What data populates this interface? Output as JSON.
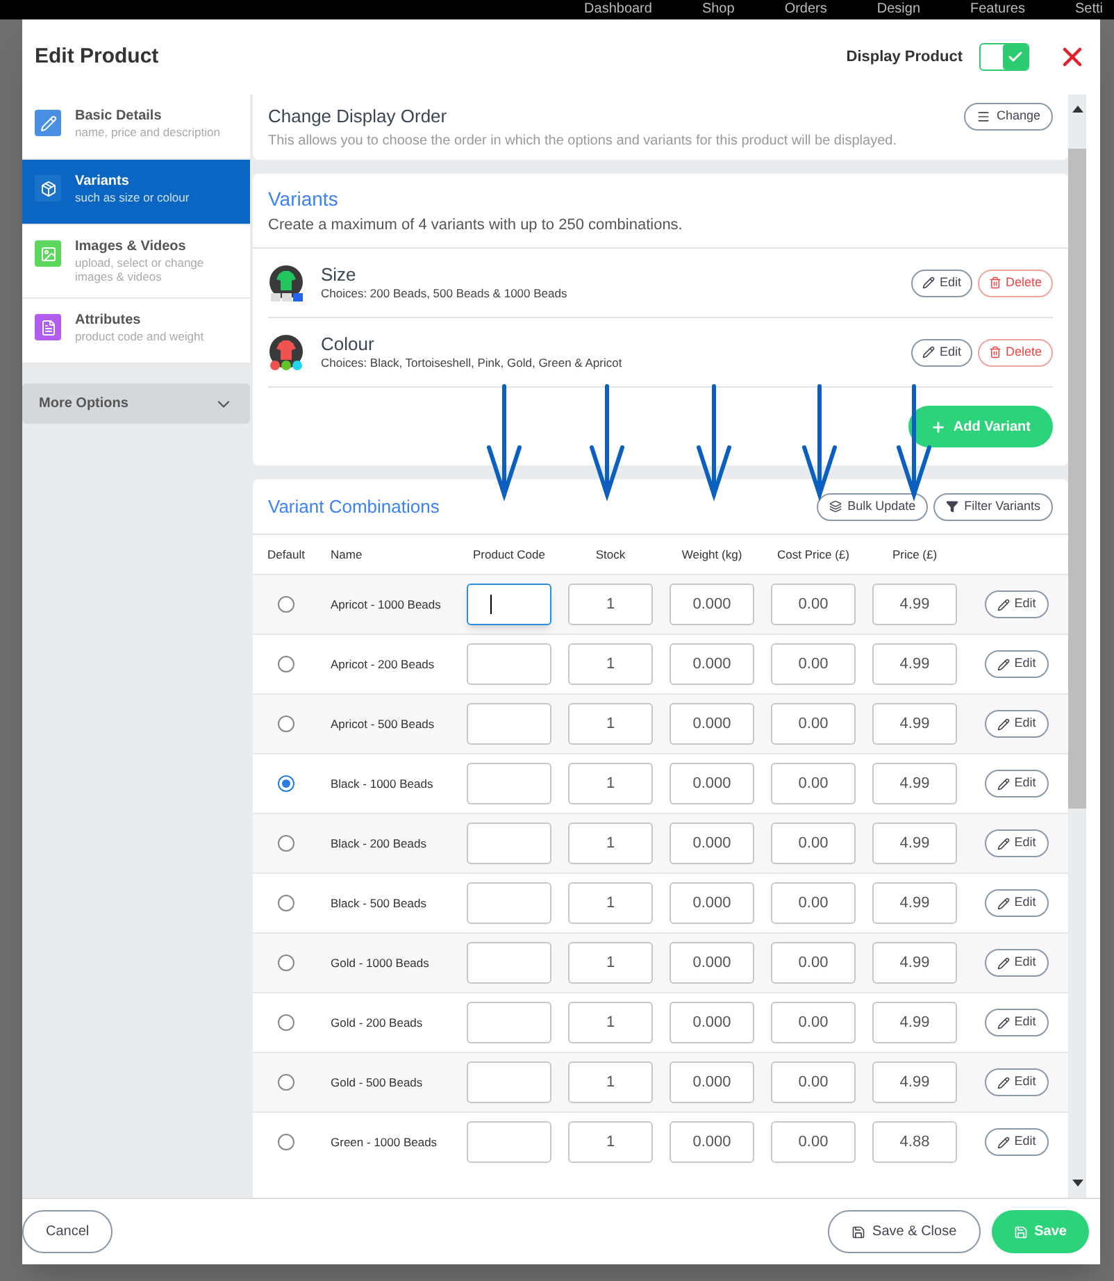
{
  "background_nav": [
    "Dashboard",
    "Shop",
    "Orders",
    "Design",
    "Features",
    "Setti"
  ],
  "dialog": {
    "title": "Edit Product",
    "display_toggle": {
      "label": "Display Product",
      "on": true
    }
  },
  "sidebar": {
    "items": [
      {
        "kind": "details",
        "title": "Basic Details",
        "subtitle": "name, price and description",
        "selected": false,
        "color": "#4a90e2"
      },
      {
        "kind": "variants",
        "title": "Variants",
        "subtitle": "such as size or colour",
        "selected": true,
        "color": "#1a73c9"
      },
      {
        "kind": "media",
        "title": "Images & Videos",
        "subtitle": "upload, select or change images & videos",
        "selected": false,
        "color": "#5cd65c"
      },
      {
        "kind": "attributes",
        "title": "Attributes",
        "subtitle": "product code and weight",
        "selected": false,
        "color": "#b35cf0"
      }
    ],
    "more_options": "More Options"
  },
  "display_order": {
    "title": "Change Display Order",
    "description": "This allows you to choose the order in which the options and variants for this product will be displayed.",
    "button": "Change"
  },
  "variants": {
    "title": "Variants",
    "description": "Create a maximum of 4 variants with up to 250 combinations.",
    "items": [
      {
        "kind": "size",
        "name": "Size",
        "choices": "Choices: 200 Beads, 500 Beads & 1000 Beads",
        "edit": "Edit",
        "delete": "Delete"
      },
      {
        "kind": "colour",
        "name": "Colour",
        "choices": "Choices: Black, Tortoiseshell, Pink, Gold, Green & Apricot",
        "edit": "Edit",
        "delete": "Delete"
      }
    ],
    "add_button": "Add Variant"
  },
  "combinations": {
    "title": "Variant Combinations",
    "bulk_button": "Bulk Update",
    "filter_button": "Filter Variants",
    "columns": [
      "Default",
      "Name",
      "Product Code",
      "Stock",
      "Weight (kg)",
      "Cost Price (£)",
      "Price (£)"
    ],
    "rows": [
      {
        "name": "Apricot - 1000 Beads",
        "stock": "1",
        "weight": "0.000",
        "cost": "0.00",
        "price": "4.99",
        "selected": false,
        "focused": true,
        "edit": "Edit"
      },
      {
        "name": "Apricot - 200 Beads",
        "stock": "1",
        "weight": "0.000",
        "cost": "0.00",
        "price": "4.99",
        "selected": false,
        "focused": false,
        "edit": "Edit"
      },
      {
        "name": "Apricot - 500 Beads",
        "stock": "1",
        "weight": "0.000",
        "cost": "0.00",
        "price": "4.99",
        "selected": false,
        "focused": false,
        "edit": "Edit"
      },
      {
        "name": "Black - 1000 Beads",
        "stock": "1",
        "weight": "0.000",
        "cost": "0.00",
        "price": "4.99",
        "selected": true,
        "focused": false,
        "edit": "Edit"
      },
      {
        "name": "Black - 200 Beads",
        "stock": "1",
        "weight": "0.000",
        "cost": "0.00",
        "price": "4.99",
        "selected": false,
        "focused": false,
        "edit": "Edit"
      },
      {
        "name": "Black - 500 Beads",
        "stock": "1",
        "weight": "0.000",
        "cost": "0.00",
        "price": "4.99",
        "selected": false,
        "focused": false,
        "edit": "Edit"
      },
      {
        "name": "Gold - 1000 Beads",
        "stock": "1",
        "weight": "0.000",
        "cost": "0.00",
        "price": "4.99",
        "selected": false,
        "focused": false,
        "edit": "Edit"
      },
      {
        "name": "Gold - 200 Beads",
        "stock": "1",
        "weight": "0.000",
        "cost": "0.00",
        "price": "4.99",
        "selected": false,
        "focused": false,
        "edit": "Edit"
      },
      {
        "name": "Gold - 500 Beads",
        "stock": "1",
        "weight": "0.000",
        "cost": "0.00",
        "price": "4.99",
        "selected": false,
        "focused": false,
        "edit": "Edit"
      },
      {
        "name": "Green - 1000 Beads",
        "stock": "1",
        "weight": "0.000",
        "cost": "0.00",
        "price": "4.88",
        "selected": false,
        "focused": false,
        "edit": "Edit"
      }
    ]
  },
  "footer": {
    "cancel": "Cancel",
    "save_close": "Save & Close",
    "save": "Save"
  }
}
